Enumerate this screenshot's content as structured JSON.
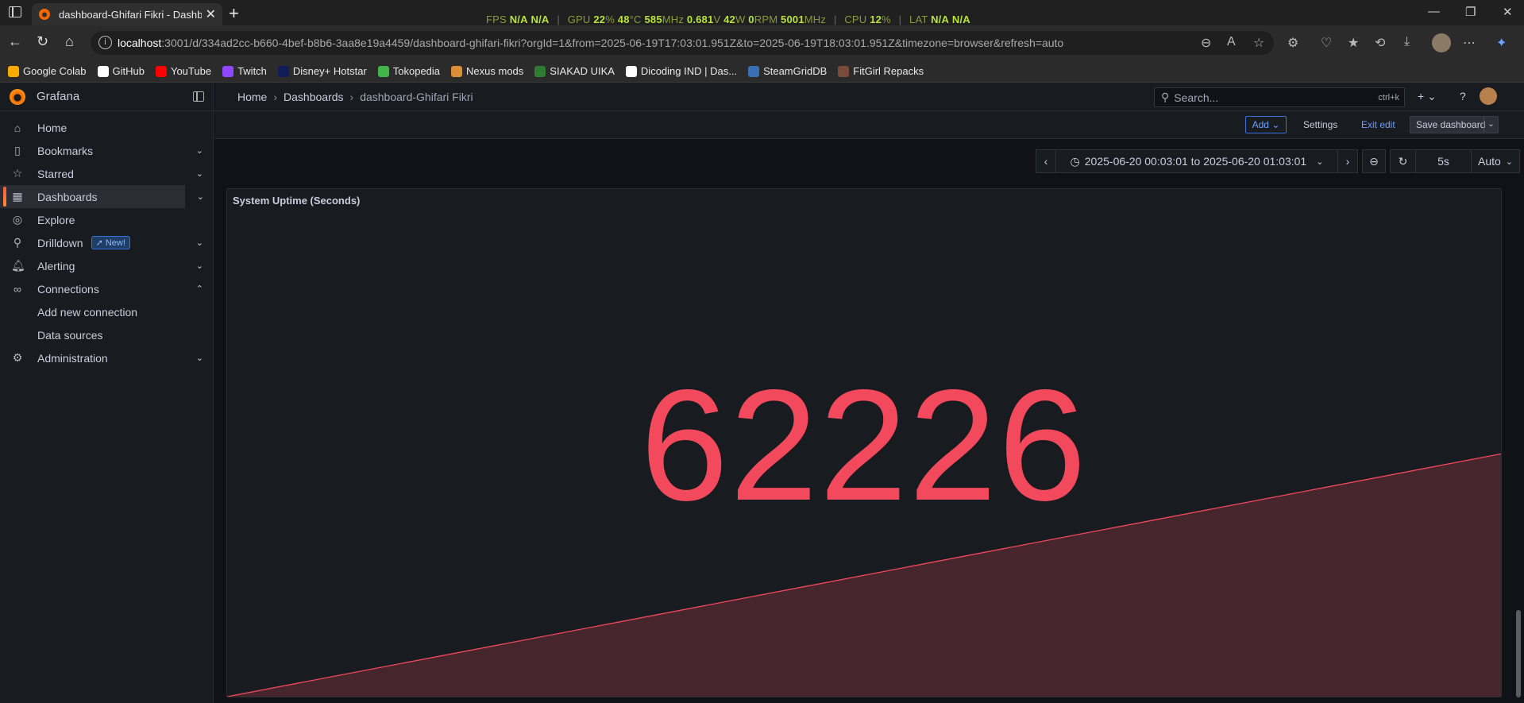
{
  "browser": {
    "tab_title": "dashboard-Ghifari Fikri - Dashboards",
    "url_host": "localhost",
    "url_rest": ":3001/d/334ad2cc-b660-4bef-b8b6-3aa8e19a4459/dashboard-ghifari-fikri?orgId=1&from=2025-06-19T17:03:01.951Z&to=2025-06-19T18:03:01.951Z&timezone=browser&refresh=auto",
    "bookmarks": [
      "Google Colab",
      "GitHub",
      "YouTube",
      "Twitch",
      "Disney+ Hotstar",
      "Tokopedia",
      "Nexus mods",
      "SIAKAD UIKA",
      "Dicoding IND | Das...",
      "SteamGridDB",
      "FitGirl Repacks"
    ],
    "bookmark_colors": [
      "#f9ab00",
      "#ffffff",
      "#ff0000",
      "#9146ff",
      "#0f1e5a",
      "#42b549",
      "#da8e35",
      "#2e7d32",
      "#ffffff",
      "#3a6fb5",
      "#7a4a3a"
    ]
  },
  "overlay": {
    "fps_label": "FPS",
    "fps_value1": "N/A",
    "fps_value2": "N/A",
    "gpu_label": "GPU",
    "gpu_load": "22",
    "gpu_load_unit": "%",
    "gpu_temp": "48",
    "gpu_temp_unit": "°C",
    "gpu_clock": "585",
    "gpu_clock_unit": "MHz",
    "gpu_volt": "0.681",
    "gpu_volt_unit": "V",
    "gpu_power": "42",
    "gpu_power_unit": "W",
    "gpu_fan": "0",
    "gpu_fan_unit": "RPM",
    "gpu_mem": "5001",
    "gpu_mem_unit": "MHz",
    "cpu_label": "CPU",
    "cpu_value": "12",
    "cpu_unit": "%",
    "lat_label": "LAT",
    "lat_value1": "N/A",
    "lat_value2": "N/A"
  },
  "grafana": {
    "brand": "Grafana",
    "nav": {
      "home": "Home",
      "bookmarks": "Bookmarks",
      "starred": "Starred",
      "dashboards": "Dashboards",
      "explore": "Explore",
      "drilldown": "Drilldown",
      "new_badge": "New!",
      "alerting": "Alerting",
      "connections": "Connections",
      "add_new_connection": "Add new connection",
      "data_sources": "Data sources",
      "administration": "Administration"
    },
    "breadcrumb": {
      "home": "Home",
      "dashboards": "Dashboards",
      "current": "dashboard-Ghifari Fikri"
    },
    "search": {
      "placeholder": "Search...",
      "shortcut": "ctrl+k"
    },
    "edit_toolbar": {
      "add": "Add",
      "settings": "Settings",
      "exit_edit": "Exit edit",
      "save": "Save dashboard"
    },
    "time_picker": {
      "range": "2025-06-20 00:03:01 to 2025-06-20 01:03:01",
      "refresh_interval": "5s",
      "mode": "Auto"
    },
    "panel": {
      "title": "System Uptime (Seconds)",
      "value": "62226",
      "color": "#f2495c",
      "sparkline_start_fraction": 0.0,
      "sparkline_end_fraction": 1.0
    }
  }
}
